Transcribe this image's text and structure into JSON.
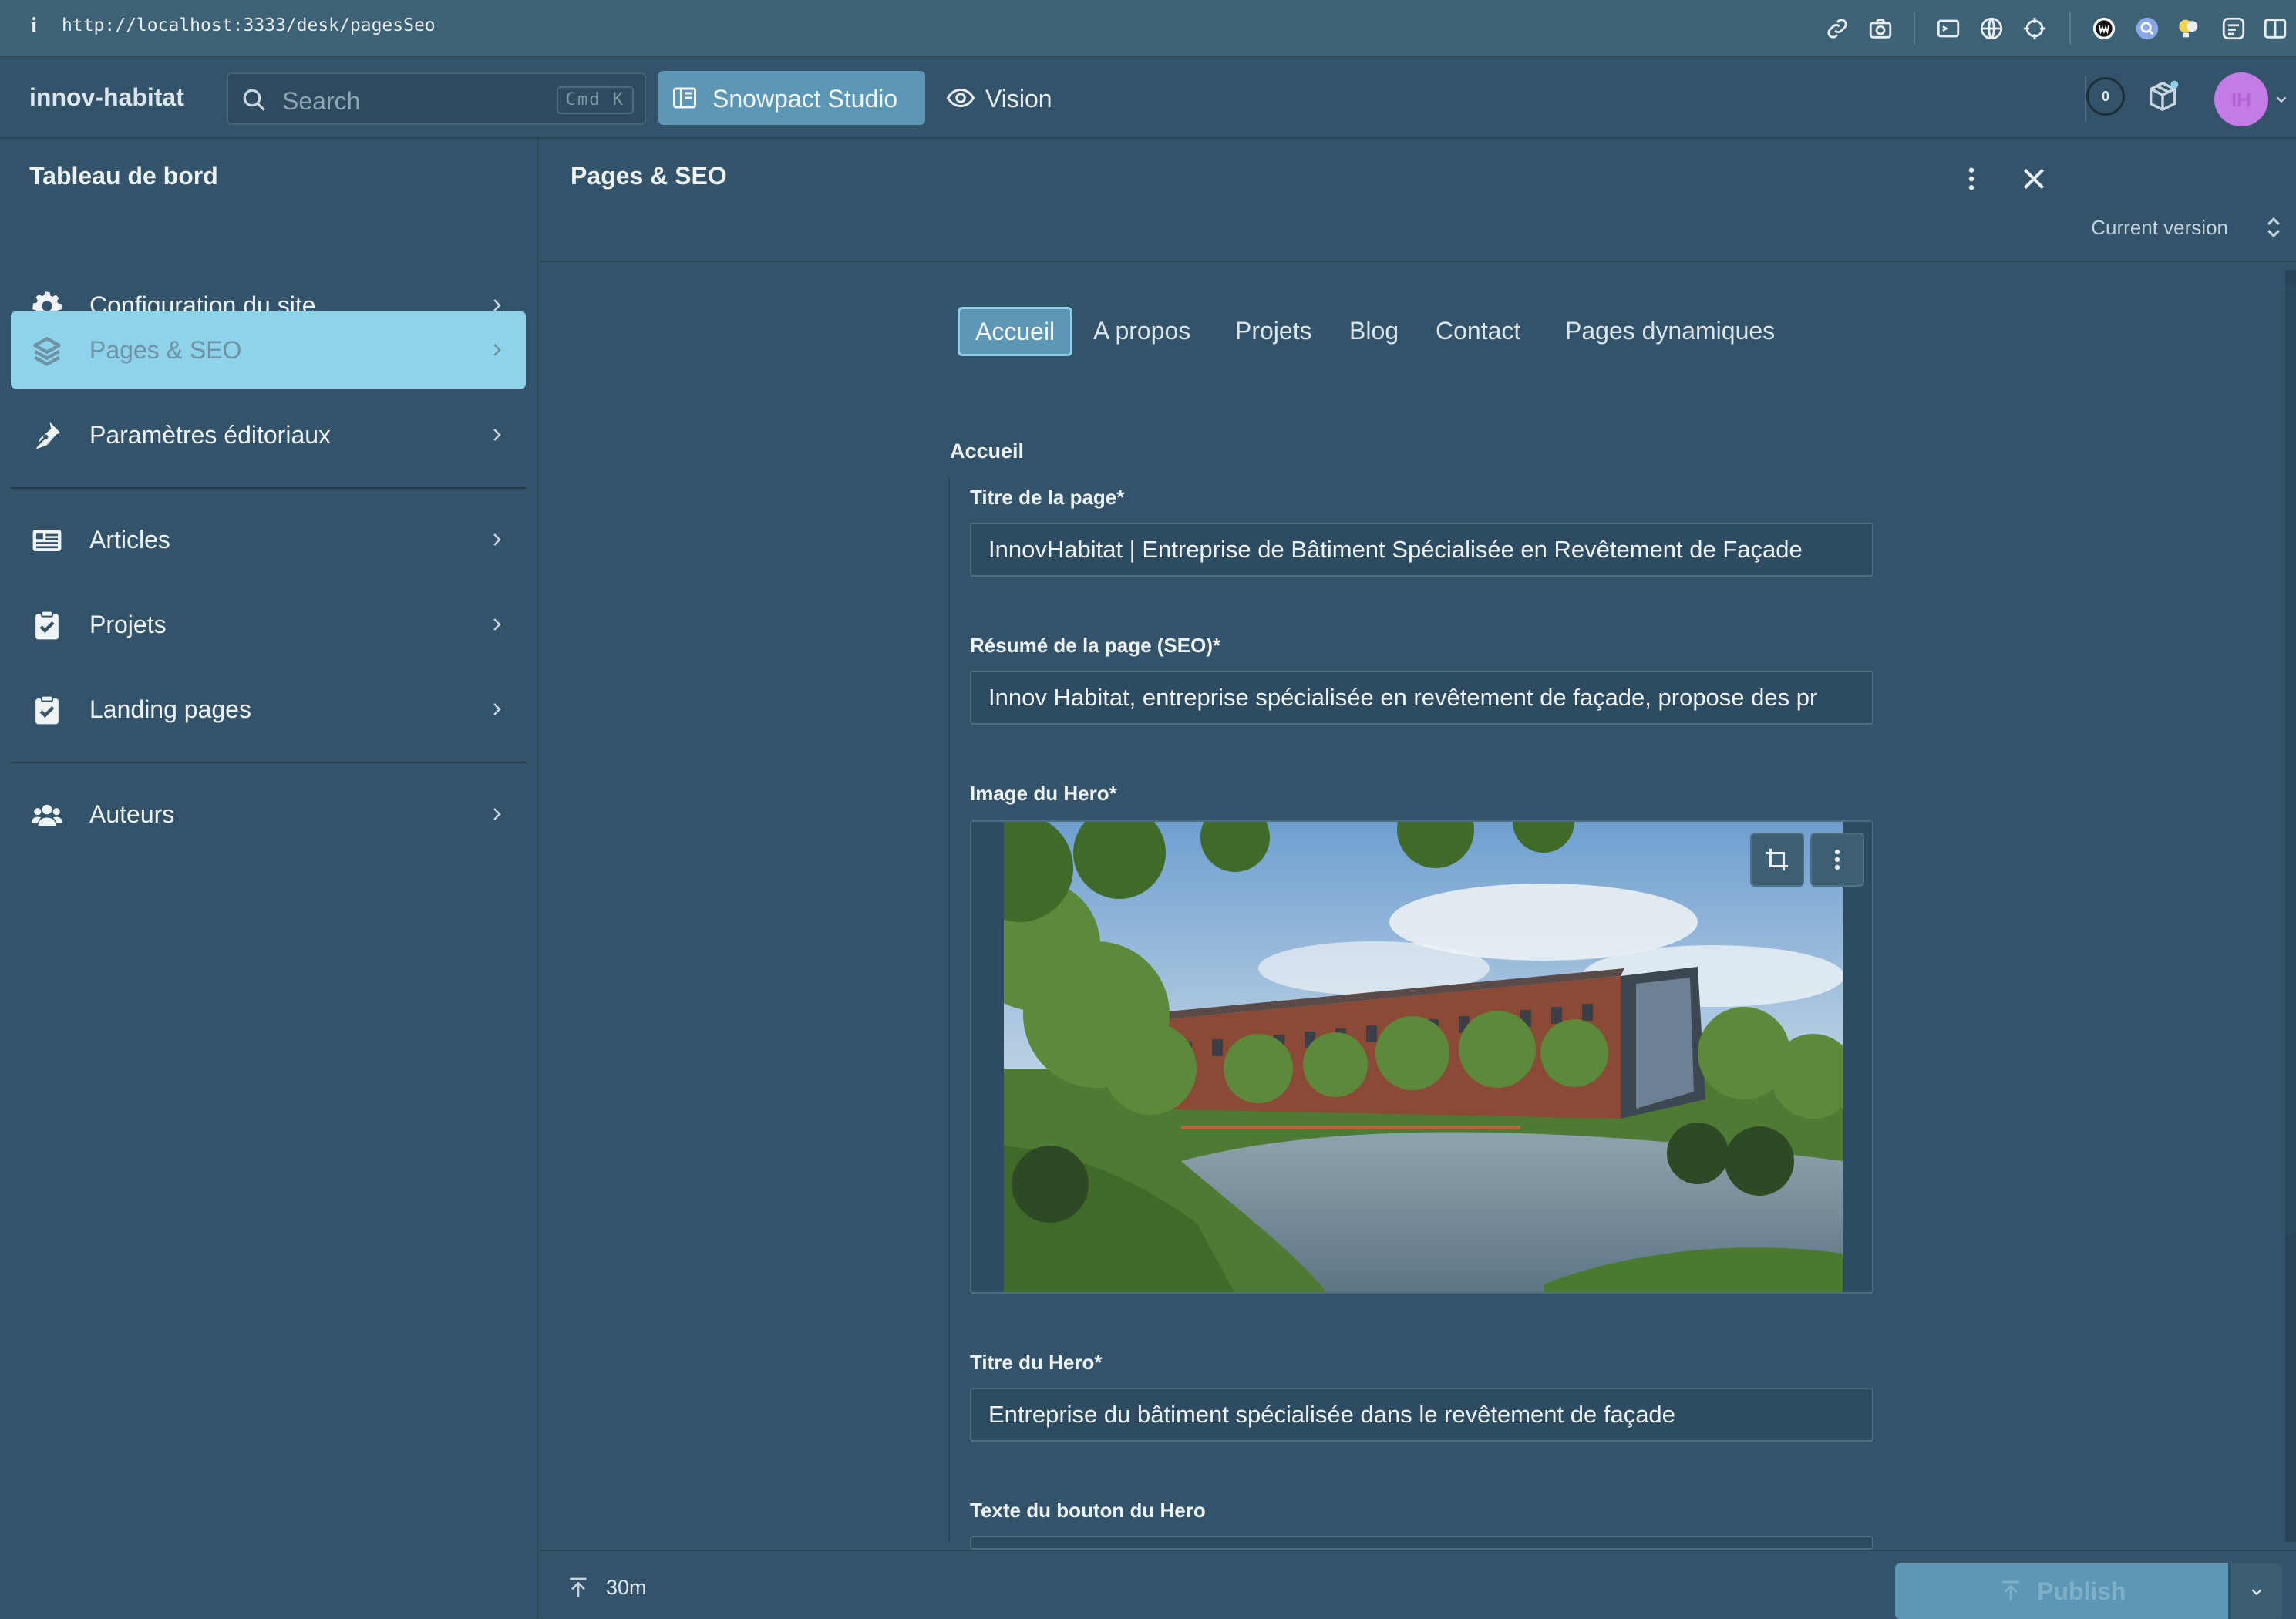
{
  "browser": {
    "url": "http://localhost:3333/desk/pagesSeo",
    "info_glyph": "i"
  },
  "header": {
    "project_name": "innov-habitat",
    "search": {
      "placeholder": "Search",
      "shortcut": "Cmd K"
    },
    "workspace_label": "Snowpact Studio",
    "vision_label": "Vision",
    "presence_count": "0",
    "user_initials": "IH"
  },
  "sidebar": {
    "title": "Tableau de bord",
    "items": [
      {
        "label": "Configuration du site",
        "icon": "gear-icon"
      },
      {
        "label": "Pages & SEO",
        "icon": "layers-icon",
        "active": true
      },
      {
        "label": "Paramètres éditoriaux",
        "icon": "pen-nib-icon"
      },
      {
        "label": "Articles",
        "icon": "newspaper-icon"
      },
      {
        "label": "Projets",
        "icon": "clipboard-check-icon"
      },
      {
        "label": "Landing pages",
        "icon": "clipboard-check-icon"
      },
      {
        "label": "Auteurs",
        "icon": "users-icon"
      }
    ]
  },
  "pane": {
    "title": "Pages & SEO",
    "version_label": "Current version",
    "tabs": [
      "Accueil",
      "A propos",
      "Projets",
      "Blog",
      "Contact",
      "Pages dynamiques"
    ],
    "active_tab": "Accueil",
    "section_title": "Accueil",
    "fields": {
      "page_title": {
        "label": "Titre de la page*",
        "value": "InnovHabitat | Entreprise de Bâtiment Spécialisée en Revêtement de Façade"
      },
      "page_summary": {
        "label": "Résumé de la page (SEO)*",
        "value": "Innov Habitat, entreprise spécialisée en revêtement de façade, propose des pr"
      },
      "hero_image": {
        "label": "Image du Hero*"
      },
      "hero_title": {
        "label": "Titre du Hero*",
        "value": "Entreprise du bâtiment spécialisée dans le revêtement de façade"
      },
      "hero_button_text": {
        "label": "Texte du bouton du Hero"
      }
    }
  },
  "footer": {
    "last_edit": "30m",
    "publish_label": "Publish"
  },
  "colors": {
    "background": "#33536a",
    "accent": "#5c97b5",
    "active_nav": "#8fd3ea",
    "avatar": "#c57be6"
  }
}
